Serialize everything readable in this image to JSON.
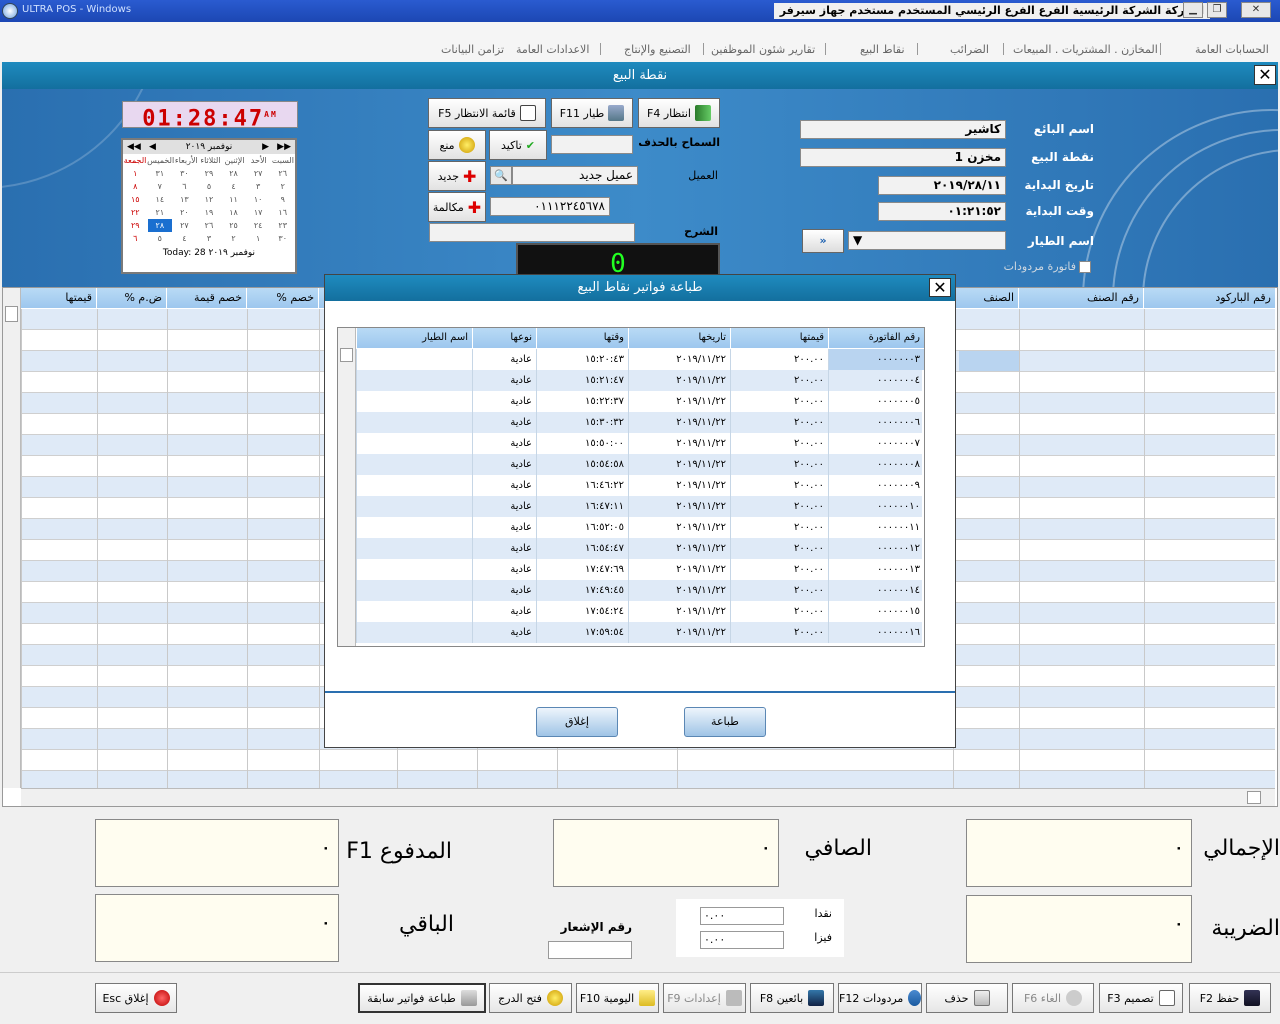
{
  "titlebar": {
    "text": "الشركة الشركة الرئيسية   الفرع الفرع الرئيسي   المستخدم مستخدم   جهاز سيرفر",
    "blurred_title": "ULTRA POS - Windows"
  },
  "menu": [
    "الحسابات العامة",
    "المخازن . المشتريات . المبيعات",
    "الضرائب",
    "نقاط البيع",
    "تقارير شئون الموظفين",
    "التصنيع والإنتاج",
    "الاعدادات العامة",
    "تزامن البيانات"
  ],
  "window": {
    "title": "نقطة البيع"
  },
  "form": {
    "seller_label": "اسم البائع",
    "seller_value": "كاشير",
    "pos_label": "نقطة البيع",
    "pos_value": "مخزن 1",
    "start_date_label": "تاريخ البداية",
    "start_date_value": "٢٠١٩/٢٨/١١",
    "start_time_label": "وقت البداية",
    "start_time_value": "٠١:٢١:٥٢",
    "pilot_label": "اسم الطيار",
    "returns_label": "فاتورة مردودات",
    "allow_delete_label": "السماح بالحذف",
    "customer_label": "العميل",
    "customer_value": "عميل جديد",
    "phone_value": "٠١١١٢٢٤٥٦٧٨",
    "notes_label": "الشرح",
    "display_digit": "0"
  },
  "topbuttons": {
    "wait": "انتظار F4",
    "pilot": "طيار F11",
    "waitlist": "قائمة الانتظار F5",
    "confirm": "تاكيد",
    "deny": "منع",
    "new": "جديد",
    "call": "مكالمة"
  },
  "clock": {
    "time": "01:28:47",
    "ampm": "AM"
  },
  "calendar": {
    "header": "نوفمبر ٢٠١٩",
    "days": [
      "السبت",
      "الأحد",
      "الإثنين",
      "الثلاثاء",
      "الأربعاء",
      "الخميس",
      "الجمعة"
    ],
    "today": "Today: 28 نوفمبر ٢٠١٩"
  },
  "grid": {
    "columns": [
      "رقم الباركود",
      "رقم الصنف",
      "الصنف",
      "خصم %",
      "خصم قيمة",
      "ض.م %",
      "قيمتها"
    ]
  },
  "modal": {
    "title": "طباعة فواتير نقاط البيع",
    "columns": [
      "رقم الفاتورة",
      "قيمتها",
      "تاريخها",
      "وقتها",
      "نوعها",
      "اسم الطيار"
    ],
    "rows": [
      [
        "٠٠٠٠٠٠٠٣",
        "٢٠٠.٠٠",
        "٢٠١٩/١١/٢٢",
        "١٥:٢٠:٤٣",
        "عادية",
        ""
      ],
      [
        "٠٠٠٠٠٠٠٤",
        "٢٠٠.٠٠",
        "٢٠١٩/١١/٢٢",
        "١٥:٢١:٤٧",
        "عادية",
        ""
      ],
      [
        "٠٠٠٠٠٠٠٥",
        "٢٠٠.٠٠",
        "٢٠١٩/١١/٢٢",
        "١٥:٢٢:٣٧",
        "عادية",
        ""
      ],
      [
        "٠٠٠٠٠٠٠٦",
        "٢٠٠.٠٠",
        "٢٠١٩/١١/٢٢",
        "١٥:٣٠:٣٢",
        "عادية",
        ""
      ],
      [
        "٠٠٠٠٠٠٠٧",
        "٢٠٠.٠٠",
        "٢٠١٩/١١/٢٢",
        "١٥:٥٠:٠٠",
        "عادية",
        ""
      ],
      [
        "٠٠٠٠٠٠٠٨",
        "٢٠٠.٠٠",
        "٢٠١٩/١١/٢٢",
        "١٥:٥٤:٥٨",
        "عادية",
        ""
      ],
      [
        "٠٠٠٠٠٠٠٩",
        "٢٠٠.٠٠",
        "٢٠١٩/١١/٢٢",
        "١٦:٤٦:٢٢",
        "عادية",
        ""
      ],
      [
        "٠٠٠٠٠٠١٠",
        "٢٠٠.٠٠",
        "٢٠١٩/١١/٢٢",
        "١٦:٤٧:١١",
        "عادية",
        ""
      ],
      [
        "٠٠٠٠٠٠١١",
        "٢٠٠.٠٠",
        "٢٠١٩/١١/٢٢",
        "١٦:٥٢:٠٥",
        "عادية",
        ""
      ],
      [
        "٠٠٠٠٠٠١٢",
        "٢٠٠.٠٠",
        "٢٠١٩/١١/٢٢",
        "١٦:٥٤:٤٧",
        "عادية",
        ""
      ],
      [
        "٠٠٠٠٠٠١٣",
        "٢٠٠.٠٠",
        "٢٠١٩/١١/٢٢",
        "١٧:٤٧:٦٩",
        "عادية",
        ""
      ],
      [
        "٠٠٠٠٠٠١٤",
        "٢٠٠.٠٠",
        "٢٠١٩/١١/٢٢",
        "١٧:٤٩:٤٥",
        "عادية",
        ""
      ],
      [
        "٠٠٠٠٠٠١٥",
        "٢٠٠.٠٠",
        "٢٠١٩/١١/٢٢",
        "١٧:٥٤:٢٤",
        "عادية",
        ""
      ],
      [
        "٠٠٠٠٠٠١٦",
        "٢٠٠.٠٠",
        "٢٠١٩/١١/٢٢",
        "١٧:٥٩:٥٤",
        "عادية",
        ""
      ]
    ],
    "print_button": "طباعة",
    "close_button": "إغلاق"
  },
  "totals": {
    "total_label": "الإجمالي",
    "net_label": "الصافي",
    "paid_label": "المدفوع F1",
    "tax_label": "الضريبة",
    "remaining_label": "الباقي",
    "notice_label": "رقم الإشعار",
    "cash_label": "نقدا",
    "visa_label": "فيزا",
    "cash_value": "٠.٠٠",
    "visa_value": "٠.٠٠",
    "total_value": "٠",
    "net_value": "٠",
    "paid_value": "٠",
    "tax_value": "٠",
    "remaining_value": "٠"
  },
  "bottombar": {
    "save": "حفظ F2",
    "design": "تصميم F3",
    "cancel": "الغاء F6",
    "delete": "حذف",
    "returns": "مردودات F12",
    "sellers": "بائعين F8",
    "settings": "إعدادات F9",
    "daily": "اليومية F10",
    "open_drawer": "فتح الدرج",
    "print_prev": "طباعة فواتير سابقة",
    "close": "إغلاق Esc"
  }
}
